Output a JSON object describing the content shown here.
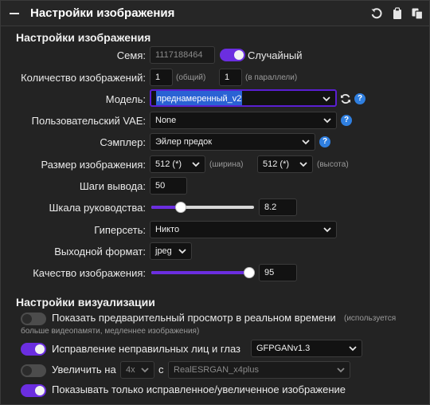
{
  "header": {
    "title": "Настройки изображения",
    "icons": [
      "collapse-icon",
      "reset-icon",
      "clipboard-icon",
      "copy-icon"
    ]
  },
  "image_settings": {
    "section_title": "Настройки изображения",
    "seed": {
      "label": "Семя:",
      "value": "1117188464",
      "random_label": "Случайный",
      "random_on": true
    },
    "num_images": {
      "label": "Количество изображений:",
      "total_value": "1",
      "total_hint": "(общий)",
      "parallel_value": "1",
      "parallel_hint": "(в параллели)"
    },
    "model": {
      "label": "Модель:",
      "value": "преднамеренный_v2"
    },
    "vae": {
      "label": "Пользовательский VAE:",
      "value": "None"
    },
    "sampler": {
      "label": "Сэмплер:",
      "value": "Эйлер предок"
    },
    "image_size": {
      "label": "Размер изображения:",
      "width_value": "512 (*)",
      "width_hint": "(ширина)",
      "height_value": "512 (*)",
      "height_hint": "(высота)"
    },
    "steps": {
      "label": "Шаги вывода:",
      "value": "50"
    },
    "guidance": {
      "label": "Шкала руководства:",
      "value": "8.2",
      "slider_fraction": 0.29
    },
    "hypernetwork": {
      "label": "Гиперсеть:",
      "value": "Никто"
    },
    "output_format": {
      "label": "Выходной формат:",
      "value": "jpeg"
    },
    "quality": {
      "label": "Качество изображения:",
      "value": "95",
      "slider_fraction": 0.95
    }
  },
  "render_settings": {
    "section_title": "Настройки визуализации",
    "live_preview": {
      "label": "Показать предварительный просмотр в реальном времени",
      "note_inline": "(используется",
      "note_line2": "больше видеопамяти, медленнее изображения)",
      "on": false
    },
    "fix_faces": {
      "label": "Исправление неправильных лиц и глаз",
      "model": "GFPGANv1.3",
      "on": true
    },
    "upscale": {
      "label": "Увеличить на",
      "factor": "4x",
      "with": "с",
      "model": "RealESRGAN_x4plus",
      "on": false
    },
    "show_only_corrected": {
      "label": "Показывать только исправленное/увеличенное изображение",
      "on": true
    }
  },
  "colors": {
    "accent": "#6b2ee0",
    "info": "#2f7fe0",
    "background": "#232323",
    "input": "#121212"
  }
}
